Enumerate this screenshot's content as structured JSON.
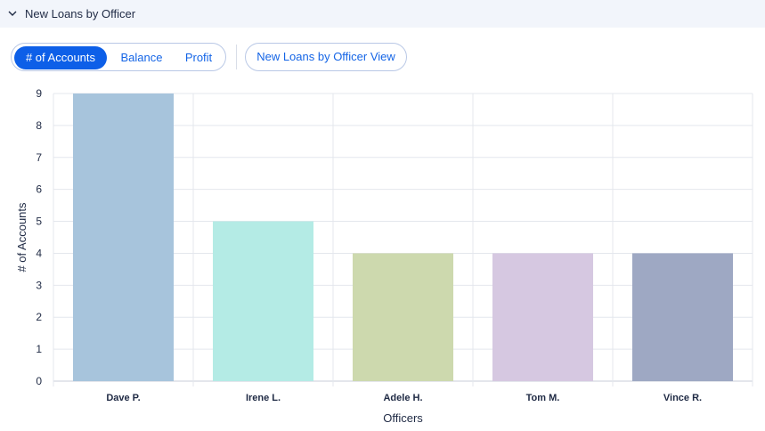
{
  "section": {
    "title": "New Loans by Officer"
  },
  "toolbar": {
    "tabs": [
      {
        "label": "# of Accounts",
        "active": true
      },
      {
        "label": "Balance",
        "active": false
      },
      {
        "label": "Profit",
        "active": false
      }
    ],
    "view_button": "New Loans by Officer View"
  },
  "colors": {
    "accent": "#0d5fe8",
    "link": "#1565e6",
    "header_bg": "#f2f5fb"
  },
  "chart_data": {
    "type": "bar",
    "categories": [
      "Dave P.",
      "Irene L.",
      "Adele H.",
      "Tom M.",
      "Vince R."
    ],
    "values": [
      9,
      5,
      4,
      4,
      4
    ],
    "colors": [
      "#a7c4dc",
      "#b4ebe5",
      "#cdd9ae",
      "#d6c8e1",
      "#9ea8c3"
    ],
    "xlabel": "Officers",
    "ylabel": "# of Accounts",
    "ylim": [
      0,
      9
    ],
    "yticks": [
      0,
      1,
      2,
      3,
      4,
      5,
      6,
      7,
      8,
      9
    ],
    "grid": true
  }
}
